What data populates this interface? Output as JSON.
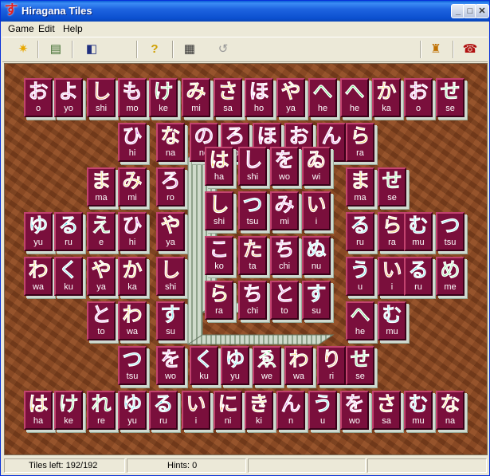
{
  "window": {
    "title": "Hiragana Tiles",
    "icon": "su-kana-icon",
    "controls": [
      "_",
      "□",
      "✕"
    ]
  },
  "menu": [
    {
      "label": "Game",
      "mnemonic": "G"
    },
    {
      "label": "Edit",
      "mnemonic": "E"
    },
    {
      "label": "Help",
      "mnemonic": "H"
    }
  ],
  "toolbar": {
    "buttons": [
      {
        "name": "new-game-button",
        "glyph": "✷"
      },
      {
        "name": "layout-button",
        "glyph": "▤"
      },
      {
        "name": "tileset-button",
        "glyph": "◧"
      },
      {
        "name": "hint-button",
        "glyph": "?"
      },
      {
        "name": "shuffle-button",
        "glyph": "▦"
      },
      {
        "name": "undo-button",
        "glyph": "↺"
      },
      {
        "name": "scores-button",
        "glyph": "♜"
      },
      {
        "name": "exit-button",
        "glyph": "☎"
      }
    ]
  },
  "colors": {
    "tile_face": "#7a0f3c",
    "yellow": "#f2c21a",
    "green": "#44dc58",
    "cyan": "#46dcea",
    "orange": "#f08a2c",
    "pink": "#e068e0"
  },
  "tiles": [
    [
      "お",
      "o",
      "pink"
    ],
    [
      "よ",
      "yo",
      "pink"
    ],
    [
      "し",
      "shi",
      "orange"
    ],
    [
      "も",
      "mo",
      "pink"
    ],
    [
      "け",
      "ke",
      "green"
    ],
    [
      "み",
      "mi",
      "yellow"
    ],
    [
      "さ",
      "sa",
      "yellow"
    ],
    [
      "ほ",
      "ho",
      "pink"
    ],
    [
      "や",
      "ya",
      "yellow"
    ],
    [
      "へ",
      "he",
      "green"
    ],
    [
      "へ",
      "he",
      "green"
    ],
    [
      "か",
      "ka",
      "yellow"
    ],
    [
      "お",
      "o",
      "pink"
    ],
    [
      "せ",
      "se",
      "green"
    ],
    [
      "ひ",
      "hi",
      "pink"
    ],
    [
      "な",
      "na",
      "yellow"
    ],
    [
      "の",
      "no",
      "pink"
    ],
    [
      "ろ",
      "ro",
      "pink"
    ],
    [
      "ほ",
      "ho",
      "pink"
    ],
    [
      "お",
      "o",
      "pink"
    ],
    [
      "ん",
      "n",
      "pink"
    ],
    [
      "ら",
      "ra",
      "yellow"
    ],
    [
      "ま",
      "ma",
      "yellow"
    ],
    [
      "み",
      "mi",
      "yellow"
    ],
    [
      "ろ",
      "ro",
      "pink"
    ],
    [
      "ま",
      "ma",
      "yellow"
    ],
    [
      "せ",
      "se",
      "green"
    ],
    [
      "ゆ",
      "yu",
      "cyan"
    ],
    [
      "る",
      "ru",
      "cyan"
    ],
    [
      "え",
      "e",
      "green"
    ],
    [
      "ひ",
      "hi",
      "pink"
    ],
    [
      "や",
      "ya",
      "yellow"
    ],
    [
      "る",
      "ru",
      "cyan"
    ],
    [
      "ら",
      "ra",
      "yellow"
    ],
    [
      "む",
      "mu",
      "cyan"
    ],
    [
      "つ",
      "tsu",
      "cyan"
    ],
    [
      "わ",
      "wa",
      "yellow"
    ],
    [
      "く",
      "ku",
      "cyan"
    ],
    [
      "や",
      "ya",
      "yellow"
    ],
    [
      "か",
      "ka",
      "yellow"
    ],
    [
      "し",
      "shi",
      "orange"
    ],
    [
      "う",
      "u",
      "cyan"
    ],
    [
      "い",
      "i",
      "orange"
    ],
    [
      "る",
      "ru",
      "cyan"
    ],
    [
      "め",
      "me",
      "green"
    ],
    [
      "と",
      "to",
      "pink"
    ],
    [
      "わ",
      "wa",
      "yellow"
    ],
    [
      "す",
      "su",
      "cyan"
    ],
    [
      "へ",
      "he",
      "green"
    ],
    [
      "む",
      "mu",
      "cyan"
    ],
    [
      "つ",
      "tsu",
      "cyan"
    ],
    [
      "を",
      "wo",
      "pink"
    ],
    [
      "く",
      "ku",
      "cyan"
    ],
    [
      "ゆ",
      "yu",
      "cyan"
    ],
    [
      "ゑ",
      "we",
      "green"
    ],
    [
      "わ",
      "wa",
      "yellow"
    ],
    [
      "り",
      "ri",
      "orange"
    ],
    [
      "せ",
      "se",
      "green"
    ],
    [
      "は",
      "ha",
      "yellow"
    ],
    [
      "け",
      "ke",
      "green"
    ],
    [
      "れ",
      "re",
      "green"
    ],
    [
      "ゆ",
      "yu",
      "cyan"
    ],
    [
      "る",
      "ru",
      "cyan"
    ],
    [
      "い",
      "i",
      "orange"
    ],
    [
      "に",
      "ni",
      "orange"
    ],
    [
      "き",
      "ki",
      "yellow"
    ],
    [
      "ん",
      "n",
      "pink"
    ],
    [
      "う",
      "u",
      "cyan"
    ],
    [
      "を",
      "wo",
      "pink"
    ],
    [
      "さ",
      "sa",
      "yellow"
    ],
    [
      "む",
      "mu",
      "cyan"
    ],
    [
      "な",
      "na",
      "yellow"
    ],
    [
      "は",
      "ha",
      "yellow"
    ],
    [
      "し",
      "shi",
      "pink"
    ],
    [
      "を",
      "wo",
      "pink"
    ],
    [
      "ゐ",
      "wi",
      "orange"
    ],
    [
      "し",
      "shi",
      "yellow"
    ],
    [
      "つ",
      "tsu",
      "cyan"
    ],
    [
      "み",
      "mi",
      "pink"
    ],
    [
      "い",
      "i",
      "orange"
    ],
    [
      "こ",
      "ko",
      "pink"
    ],
    [
      "た",
      "ta",
      "orange"
    ],
    [
      "ち",
      "chi",
      "pink"
    ],
    [
      "ぬ",
      "nu",
      "cyan"
    ],
    [
      "ら",
      "ra",
      "yellow"
    ],
    [
      "ち",
      "chi",
      "pink"
    ],
    [
      "と",
      "to",
      "pink"
    ],
    [
      "す",
      "su",
      "cyan"
    ]
  ],
  "status": {
    "tiles_left": "Tiles left:  192/192",
    "hints": "Hints:  0"
  }
}
